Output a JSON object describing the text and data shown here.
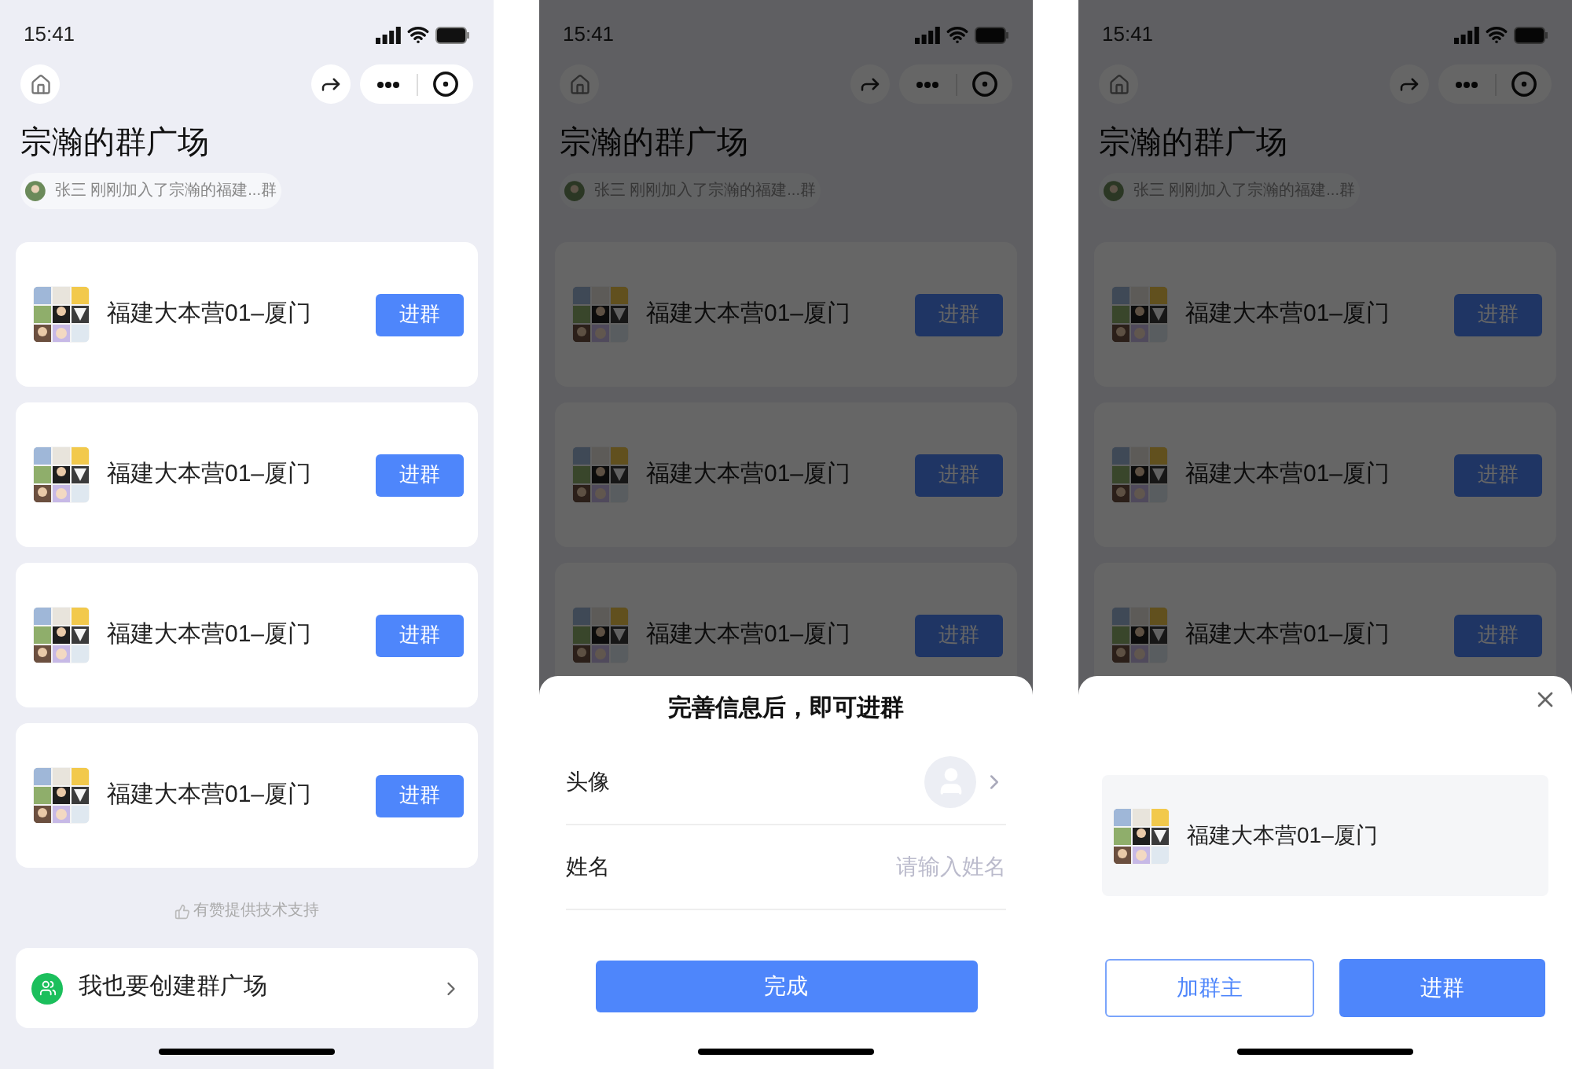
{
  "screens": [
    {
      "status_time": "15:41",
      "title": "宗瀚的群广场",
      "notice": "张三 刚刚加入了宗瀚的福建...群",
      "groups": [
        {
          "name": "福建大本营01–厦门",
          "button": "进群"
        },
        {
          "name": "福建大本营01–厦门",
          "button": "进群"
        },
        {
          "name": "福建大本营01–厦门",
          "button": "进群"
        },
        {
          "name": "福建大本营01–厦门",
          "button": "进群"
        }
      ],
      "support": "有赞提供技术支持",
      "create_label": "我也要创建群广场"
    },
    {
      "status_time": "15:41",
      "title": "宗瀚的群广场",
      "notice": "张三 刚刚加入了宗瀚的福建...群",
      "groups": [
        {
          "name": "福建大本营01–厦门",
          "button": "进群"
        },
        {
          "name": "福建大本营01–厦门",
          "button": "进群"
        },
        {
          "name": "福建大本营01–厦门",
          "button": "进群"
        }
      ],
      "sheet": {
        "kind": "profile_form",
        "title": "完善信息后，即可进群",
        "rows": [
          {
            "kind": "avatar",
            "label": "头像"
          },
          {
            "kind": "text",
            "label": "姓名",
            "placeholder": "请输入姓名"
          }
        ],
        "button": "完成"
      }
    },
    {
      "status_time": "15:41",
      "title": "宗瀚的群广场",
      "notice": "张三 刚刚加入了宗瀚的福建...群",
      "groups": [
        {
          "name": "福建大本营01–厦门",
          "button": "进群"
        },
        {
          "name": "福建大本营01–厦门",
          "button": "进群"
        },
        {
          "name": "福建大本营01–厦门",
          "button": "进群"
        }
      ],
      "sheet": {
        "kind": "group_join",
        "group": "福建大本营01–厦门",
        "buttons": [
          {
            "label": "加群主",
            "kind": "outline"
          },
          {
            "label": "进群",
            "kind": "primary"
          }
        ]
      }
    }
  ]
}
